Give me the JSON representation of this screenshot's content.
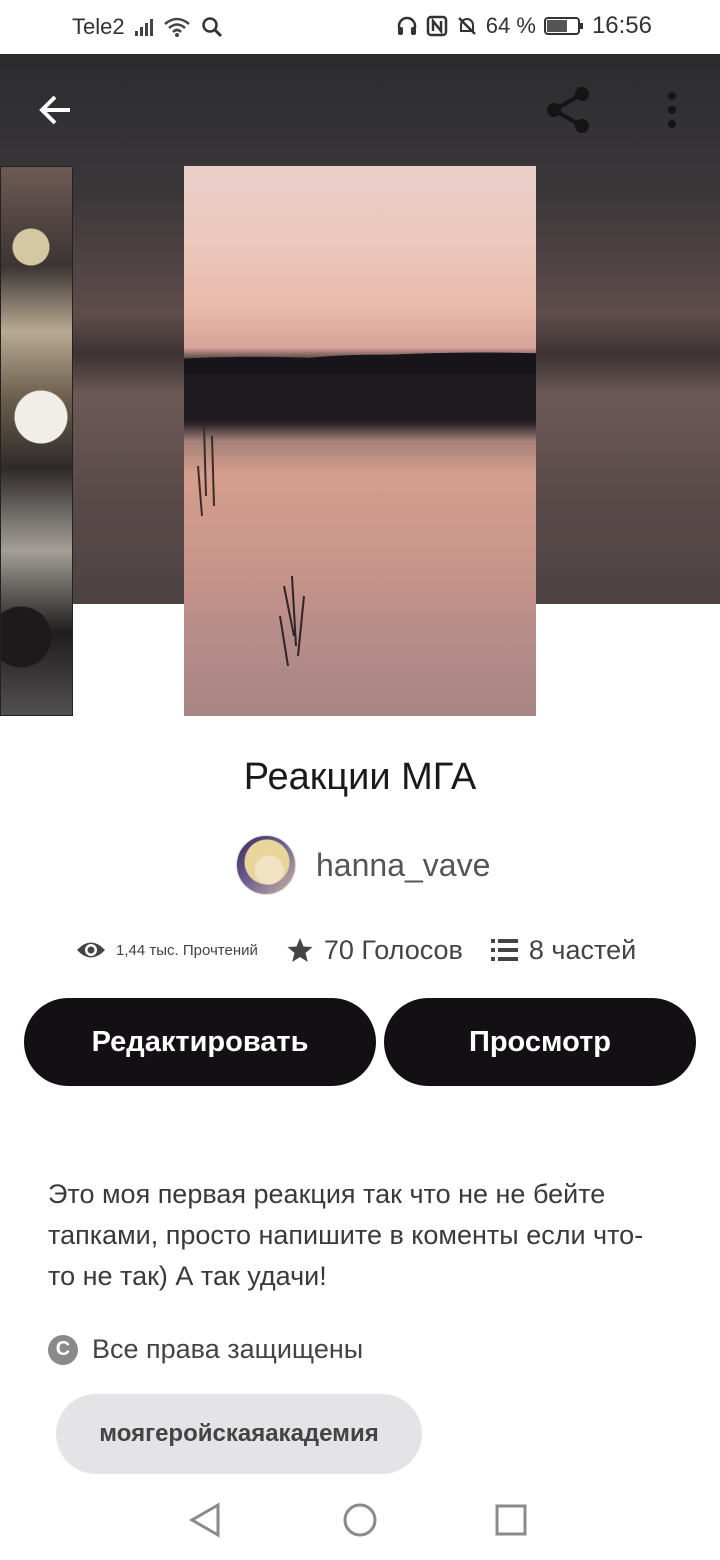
{
  "status_bar": {
    "carrier": "Tele2",
    "battery": "64 %",
    "time": "16:56"
  },
  "story": {
    "title": "Реакции МГА",
    "author": "hanna_vave",
    "reads": "1,44 тыс. Прочтений",
    "votes": "70 Голосов",
    "parts": "8 частей",
    "description": "Это моя первая реакция так что не не бейте тапками, просто напишите в коменты если что-то не так) А так удачи!",
    "rights": "Все права защищены",
    "copyright_symbol": "C",
    "tag": "моягеройскаяакадемия"
  },
  "actions": {
    "edit_label": "Редактировать",
    "view_label": "Просмотр"
  },
  "icons": {
    "back": "arrow-left-icon",
    "share": "share-icon",
    "more": "more-vertical-icon",
    "reads": "eye-icon",
    "votes": "star-icon",
    "parts": "list-icon"
  },
  "colors": {
    "button_bg": "#121012",
    "tag_bg": "#e4e4e6",
    "hero_top": "#2b2b2e"
  }
}
